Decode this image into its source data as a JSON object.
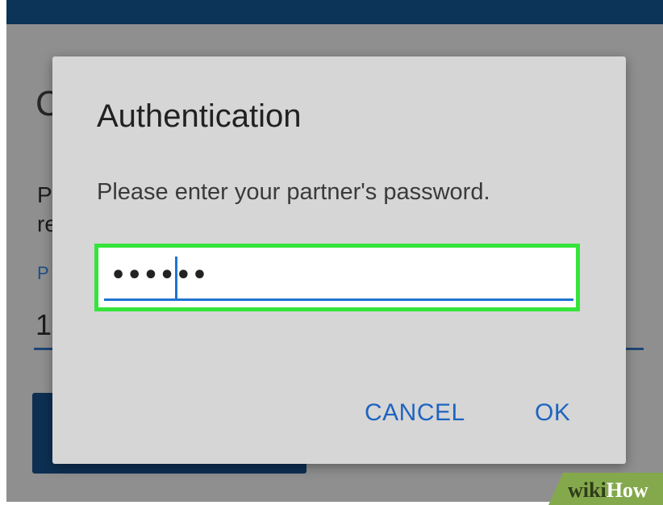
{
  "background": {
    "heading": "C",
    "line1": "P",
    "line2": "re",
    "label": "P",
    "value": "1"
  },
  "dialog": {
    "title": "Authentication",
    "message": "Please enter your partner's password.",
    "password_value": "••••••",
    "cancel_label": "CANCEL",
    "ok_label": "OK"
  },
  "watermark": {
    "part1": "wiki",
    "part2": "How"
  },
  "colors": {
    "topbar": "#0c3358",
    "accent": "#1e74d2",
    "highlight": "#35e43a",
    "button_text": "#1e64c0",
    "watermark_bg": "#84a84c"
  }
}
